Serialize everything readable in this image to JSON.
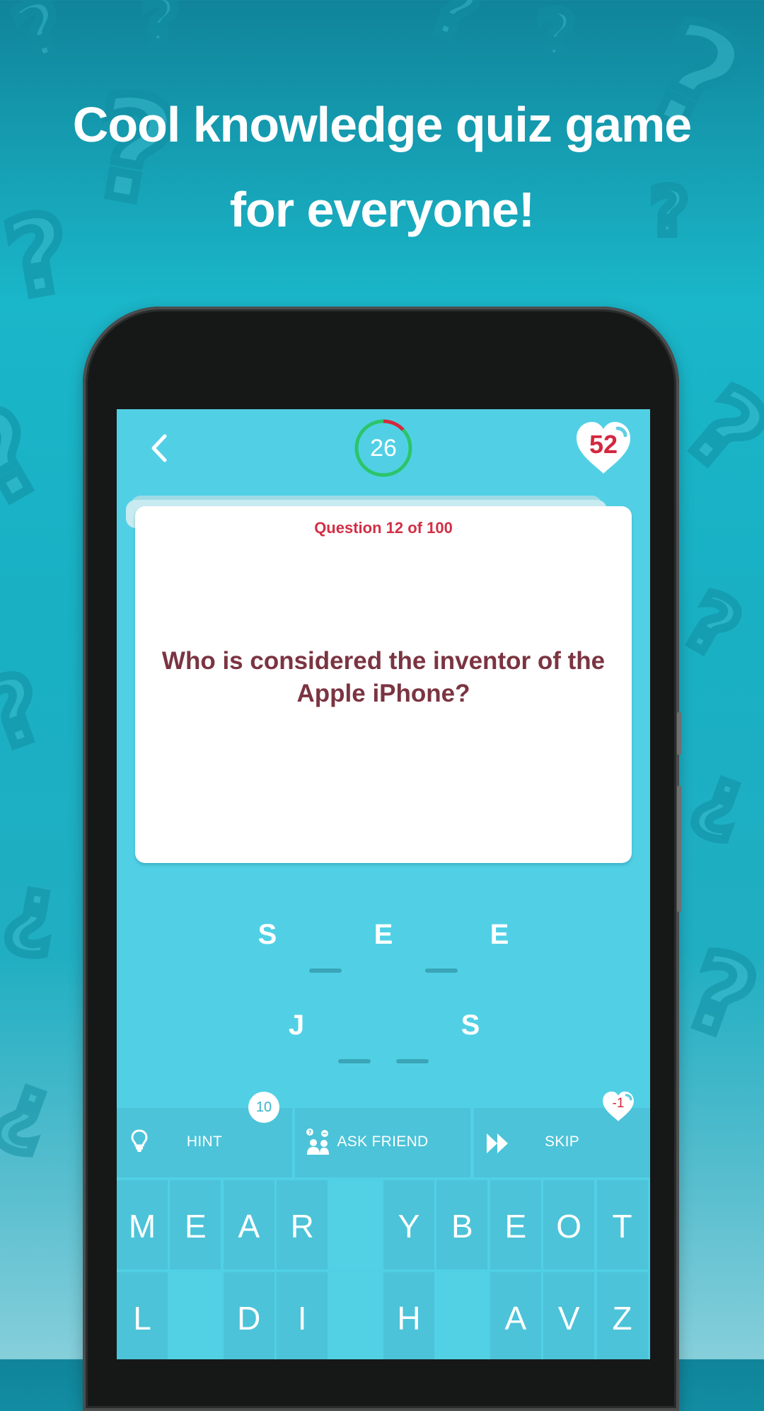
{
  "promo": {
    "line1": "Cool knowledge quiz game",
    "line2": "for everyone!"
  },
  "colors": {
    "screen_bg": "#51d0e5",
    "timer_green": "#2cc46a",
    "timer_red": "#d4283f",
    "question_counter": "#d22f45",
    "question_text": "#7b3441"
  },
  "top_bar": {
    "back_icon": "chevron-left-icon",
    "timer_value": "26",
    "timer_elapsed_fraction": 0.13,
    "lives": "52",
    "lives_icon": "heart-icon"
  },
  "card": {
    "counter": "Question 12 of 100",
    "question": "Who is considered the inventor of the Apple iPhone?"
  },
  "answer": {
    "words": [
      [
        "S",
        "",
        "E",
        "",
        "E"
      ],
      [
        "J",
        "",
        "",
        "S"
      ]
    ]
  },
  "actions": [
    {
      "id": "hint",
      "label": "HINT",
      "icon": "lightbulb-icon",
      "badge": "10"
    },
    {
      "id": "ask-friend",
      "label": "ASK FRIEND",
      "icon": "friends-icon",
      "badge": null
    },
    {
      "id": "skip",
      "label": "SKIP",
      "icon": "fast-forward-icon",
      "badge": "-1"
    }
  ],
  "keyboard": {
    "rows": [
      [
        "M",
        "E",
        "A",
        "R",
        "",
        "Y",
        "B",
        "E",
        "O",
        "T"
      ],
      [
        "L",
        "",
        "D",
        "I",
        "",
        "H",
        "",
        "A",
        "V",
        "Z"
      ]
    ]
  }
}
